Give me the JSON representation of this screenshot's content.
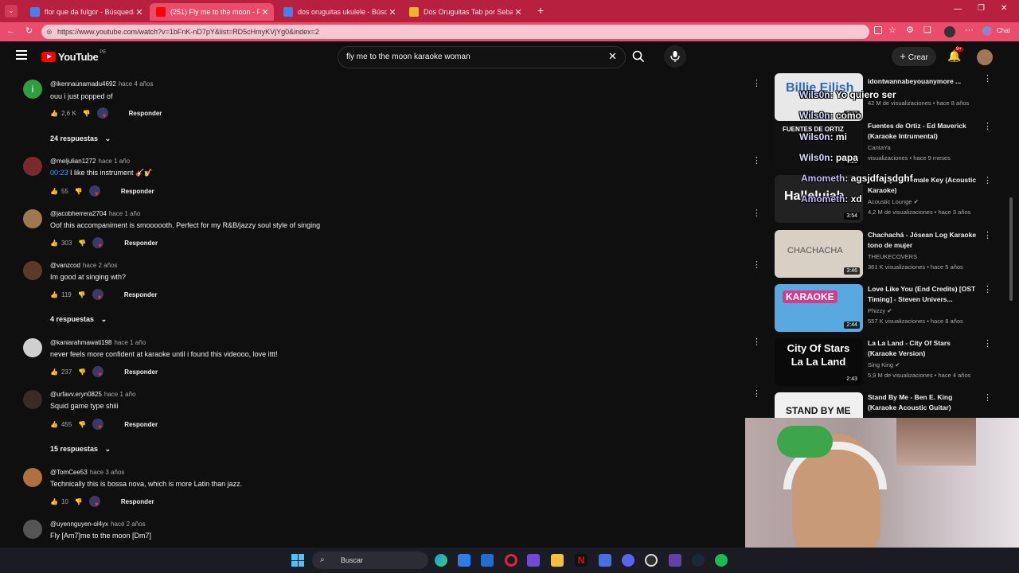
{
  "browser": {
    "tabs": [
      {
        "label": "flor que da fulgor - Búsqueda",
        "color": "#4a7ee8"
      },
      {
        "label": "(251) Fly me to the moon - Frank S",
        "color": "#ff0000"
      },
      {
        "label": "dos oruguitas ukulele - Búsqueda",
        "color": "#4a7ee8"
      },
      {
        "label": "Dos Oruguitas Tab por Sebastián Y",
        "color": "#f0b429"
      }
    ],
    "url": "https://www.youtube.com/watch?v=1bFnK-nD7pY&list=RD5cHmyKVjYg0&index=2",
    "chat_label": "Chat"
  },
  "youtube": {
    "logo": "YouTube",
    "country": "PE",
    "search_value": "fly me to the moon karaoke woman",
    "create_label": "Crear",
    "notif_count": "9+"
  },
  "comments": [
    {
      "author": "@ikennaunamadu4692",
      "when": "hace 4 años",
      "text": "ouu i just popped of",
      "likes": "2,6 K",
      "reply": "Responder",
      "avatar_color": "#2e9e3f",
      "avatar_letter": "i"
    },
    {
      "author": "@meljulian1272",
      "when": "hace 1 año",
      "ts": "00:23",
      "text": " I like this instrument 🎸🎷",
      "likes": "55",
      "reply": "Responder",
      "avatar_color": "#7a2a2a"
    },
    {
      "author": "@jacobherrera2704",
      "when": "hace 1 año",
      "text": "Oof this accompaniment is smoooooth. Perfect for my R&B/jazzy soul style of singing",
      "likes": "303",
      "reply": "Responder",
      "avatar_color": "#a07850"
    },
    {
      "author": "@vanzcod",
      "when": "hace 2 años",
      "text": "Im good at singing wth?",
      "likes": "119",
      "reply": "Responder",
      "avatar_color": "#5a3a2a"
    },
    {
      "author": "@kaniarahmawati198",
      "when": "hace 1 año",
      "text": "never feels more confident at karaoke until i found this videooo, love ittt!",
      "likes": "237",
      "reply": "Responder",
      "avatar_color": "#cfcfcf"
    },
    {
      "author": "@urfavv.eryn0825",
      "when": "hace 1 año",
      "text": "Squid game type shiii",
      "likes": "455",
      "reply": "Responder",
      "avatar_color": "#3a2a2a"
    },
    {
      "author": "@TomCee53",
      "when": "hace 3 años",
      "text": "Technically this is bossa nova, which is more Latin than jazz.",
      "likes": "10",
      "reply": "Responder",
      "avatar_color": "#b07040"
    },
    {
      "author": "@uyennguyen-ol4yx",
      "when": "hace 2 años",
      "text": "Fly [Am7]me to the moon [Dm7]",
      "likes": "",
      "reply": "",
      "avatar_color": "#555"
    }
  ],
  "replies_toggles": [
    "24 respuestas",
    "4 respuestas",
    "15 respuestas"
  ],
  "sidebar": [
    {
      "title": "idontwannabeyouanymore ...",
      "channel": "",
      "meta": "42 M de visualizaciones • hace 8 años",
      "duration": "3:47",
      "thumb_text": "Billie Eilish",
      "thumb_bg": "#e8e8e8",
      "thumb_fg": "#2a6ab8"
    },
    {
      "title": "Fuentes de Ortiz - Ed Maverick (Karaoke Intrumental)",
      "channel": "CantaYa",
      "meta": "visualizaciones • hace 9 meses",
      "duration": "3:20",
      "thumb_text": "FUENTES DE ORTIZ",
      "thumb_bg": "#111",
      "thumb_fg": "#fff"
    },
    {
      "title": "Hallelujah - Female Key (Acoustic Karaoke)",
      "channel": "Acoustic Lounge",
      "meta": "4,2 M de visualizaciones • hace 3 años",
      "duration": "3:54",
      "thumb_text": "Hallelujah",
      "thumb_bg": "#222",
      "thumb_fg": "#fff"
    },
    {
      "title": "Chachachá - Jósean Log Karaoke tono de mujer",
      "channel": "THEUKECOVERS",
      "meta": "361 K visualizaciones • hace 5 años",
      "duration": "3:46",
      "thumb_text": "CHACHACHA",
      "thumb_bg": "#d8d0c4",
      "thumb_fg": "#555"
    },
    {
      "title": "Love Like You (End Credits) [OST Timing] - Steven Univers...",
      "channel": "Phizzy",
      "meta": "557 K visualizaciones • hace 8 años",
      "duration": "2:44",
      "thumb_text": "KARAOKE",
      "thumb_bg": "#5aa8e0",
      "thumb_fg": "#fff"
    },
    {
      "title": "La La Land - City Of Stars (Karaoke Version)",
      "channel": "Sing King",
      "meta": "5,9 M de visualizaciones • hace 4 años",
      "duration": "2:43",
      "thumb_text": "City Of Stars La La Land",
      "thumb_bg": "#0a0a0a",
      "thumb_fg": "#fff"
    },
    {
      "title": "Stand By Me - Ben E. King (Karaoke Acoustic Guitar)",
      "channel": "",
      "meta": "",
      "duration": "",
      "thumb_text": "STAND BY ME",
      "thumb_bg": "#f0f0f0",
      "thumb_fg": "#111"
    }
  ],
  "chat_overlay": [
    {
      "name": "Wils0n",
      "msg": ": Yo quiero ser"
    },
    {
      "name": "Wils0n",
      "msg": ": como"
    },
    {
      "name": "Wils0n",
      "msg": ": mi"
    },
    {
      "name": "Wils0n",
      "msg": ": papa"
    },
    {
      "name": "Amometh",
      "msg": ": agsjdfajsdghf"
    },
    {
      "name": "Amometh",
      "msg": ": xd"
    }
  ],
  "taskbar": {
    "search_placeholder": "Buscar"
  }
}
